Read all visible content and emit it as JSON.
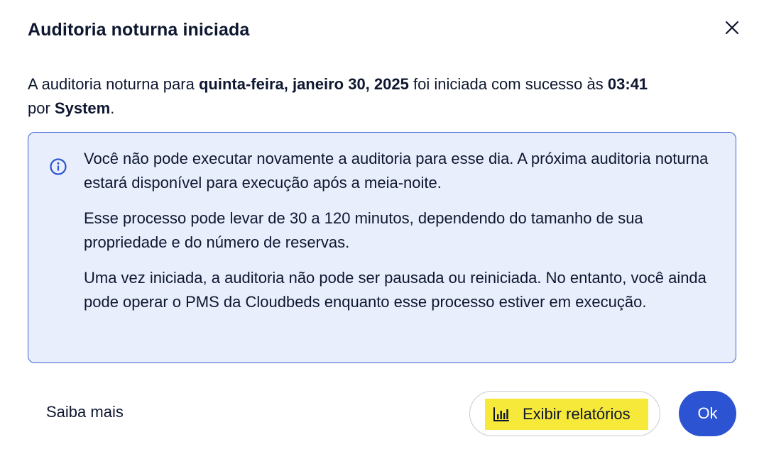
{
  "dialog": {
    "title": "Auditoria noturna iniciada",
    "close_icon": "close-icon"
  },
  "summary": {
    "part1": "A auditoria noturna para ",
    "date": "quinta-feira, janeiro 30, 2025",
    "part2": " foi iniciada com sucesso às ",
    "time": "03:41",
    "part3": "por ",
    "user": "System",
    "part4": "."
  },
  "info": {
    "icon": "info-icon",
    "paragraphs": [
      "Você não pode executar novamente a auditoria para esse dia. A próxima auditoria noturna estará disponível para execução após a meia-noite.",
      "Esse processo pode levar de 30 a 120 minutos, dependendo do tamanho de sua propriedade e do número de reservas.",
      "Uma vez iniciada, a auditoria não pode ser pausada ou reiniciada. No entanto, você ainda pode operar o PMS da Cloudbeds enquanto esse processo estiver em execução."
    ],
    "colors": {
      "background": "#e8eefb",
      "border": "#3d63d6"
    }
  },
  "footer": {
    "learn_more_label": "Saiba mais",
    "reports_label": "Exibir relatórios",
    "reports_icon": "bar-chart-icon",
    "ok_label": "Ok"
  },
  "colors": {
    "accent": "#2c53d1",
    "highlight": "#f7e93a",
    "text": "#0e1730"
  }
}
